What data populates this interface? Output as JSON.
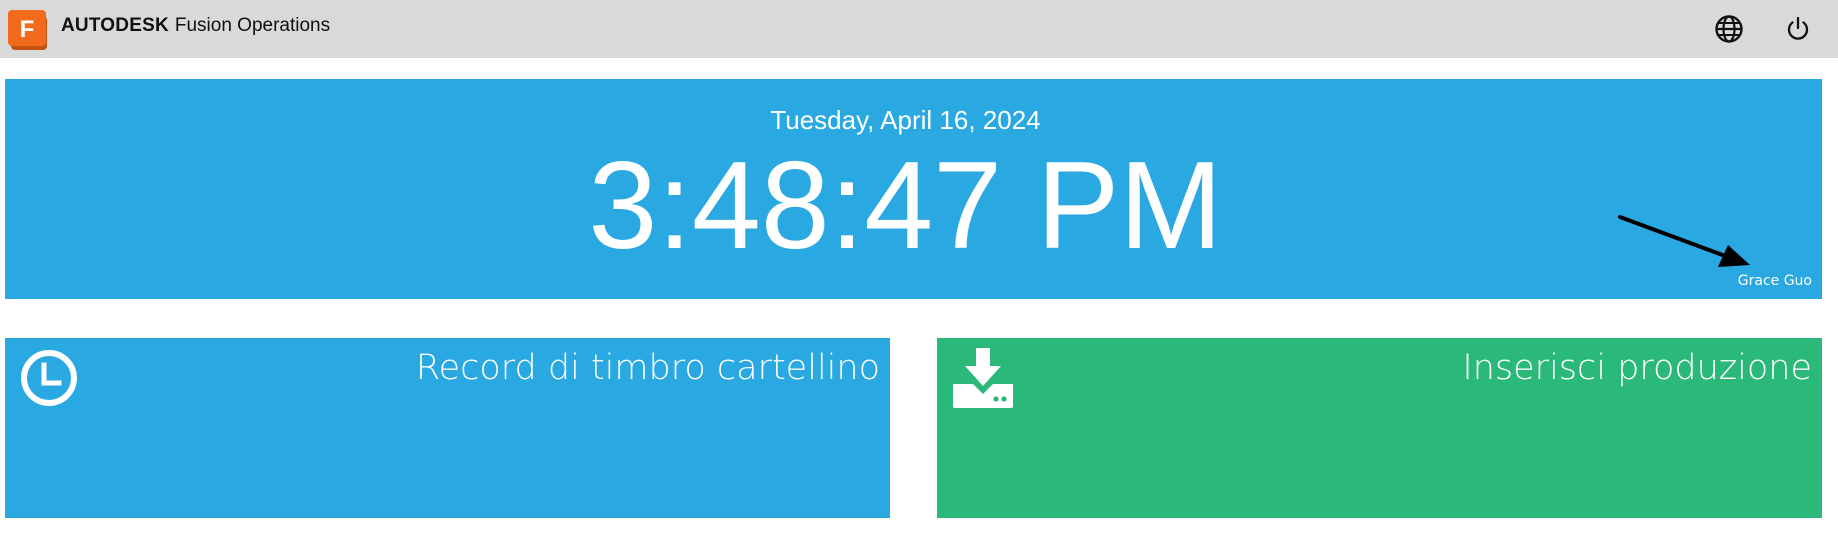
{
  "header": {
    "brand_bold": "AUTODESK",
    "brand_product": "Fusion Operations",
    "logo_letter": "F",
    "icons": {
      "logo": "fusion-logo-icon",
      "language": "globe-icon",
      "logout": "power-icon"
    }
  },
  "clock": {
    "date": "Tuesday, April 16, 2024",
    "time": "3:48:47 PM",
    "user": "Grace Guo",
    "annotation": "arrow-icon"
  },
  "tiles": [
    {
      "label": "Record di timbro cartellino",
      "icon": "clock-icon",
      "color": "#29a8e2"
    },
    {
      "label": "Inserisci produzione",
      "icon": "download-icon",
      "color": "#2bb979"
    }
  ],
  "colors": {
    "topbar": "#d9d9d9",
    "clock_panel": "#29a8e2",
    "logo_orange": "#f26b1d"
  }
}
